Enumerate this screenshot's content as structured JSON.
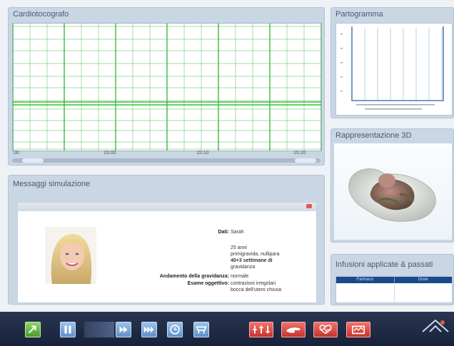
{
  "panels": {
    "ctg": {
      "title": "Cardiotocografo",
      "time_labels": [
        "00",
        "15:00",
        "15:10",
        "15:20"
      ]
    },
    "partogram": {
      "title": "Partogramma"
    },
    "rep3d": {
      "title": "Rappresentazione 3D"
    },
    "infusions": {
      "title": "Infusioni applicate & passati",
      "columns": [
        "Farmaco",
        "Dose"
      ]
    },
    "messages": {
      "title": "Messaggi simulazione",
      "patient": {
        "dati_label": "Dati:",
        "name": "Sarah",
        "details": [
          "25 anni",
          "primigravida, nullipara",
          "40+3 settimane di",
          "gravidanza"
        ],
        "gravidanza_label": "Andamento della gravidanza:",
        "gravidanza_value": "normale",
        "esame_label": "Esame oggettivo:",
        "esame_value": [
          "contrazioni irregolari",
          "bocca dell'utero chiusa"
        ]
      }
    }
  },
  "toolbar": {
    "buttons": [
      "exit",
      "pause",
      "play",
      "fast-forward",
      "clock",
      "bed",
      "ctg-settings",
      "hand",
      "heart-monitor",
      "ctg-print"
    ],
    "colors": {
      "blue": "#7aa9db",
      "red": "#e0483e",
      "green": "#6bbf45",
      "bar": "#1f2a44"
    }
  },
  "colors": {
    "grid": "#2fb82f",
    "panel": "#c9d6e4",
    "infusion_header": "#1b4a8c"
  }
}
